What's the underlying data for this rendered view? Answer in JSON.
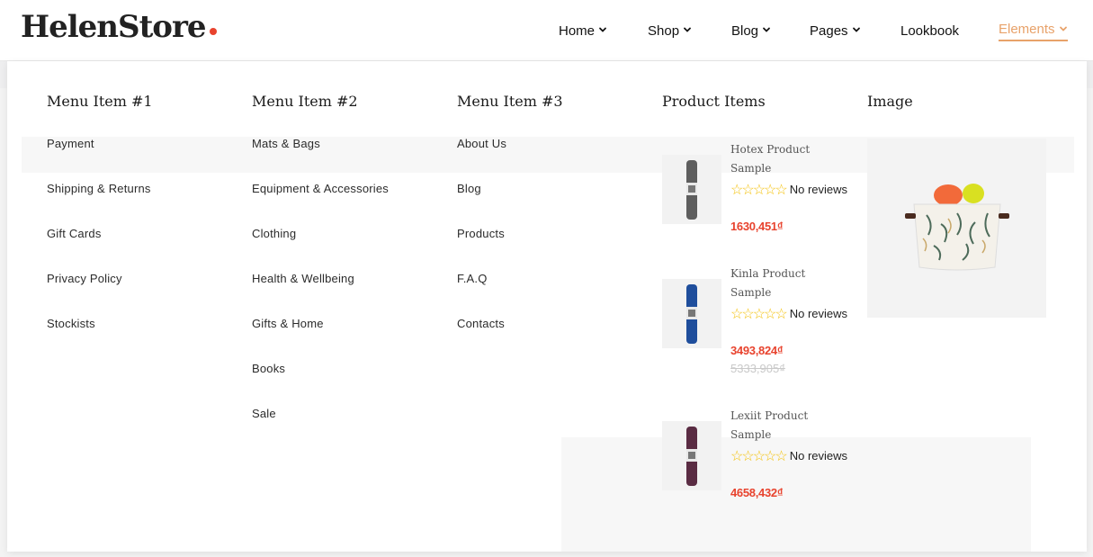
{
  "brand": {
    "name": "HelenStore",
    "dot_color": "#e8432e"
  },
  "nav": [
    {
      "label": "Home",
      "has_dropdown": true,
      "active": false
    },
    {
      "label": "Shop",
      "has_dropdown": true,
      "active": false
    },
    {
      "label": "Blog",
      "has_dropdown": true,
      "active": false
    },
    {
      "label": "Pages",
      "has_dropdown": true,
      "active": false
    },
    {
      "label": "Lookbook",
      "has_dropdown": false,
      "active": false
    },
    {
      "label": "Elements",
      "has_dropdown": true,
      "active": true
    }
  ],
  "colors": {
    "accent": "#e8a26a",
    "price": "#e8432e",
    "star": "#f4c20d"
  },
  "megamenu": {
    "col1": {
      "title": "Menu Item #1",
      "items": [
        "Payment",
        "Shipping & Returns",
        "Gift Cards",
        "Privacy Policy",
        "Stockists"
      ]
    },
    "col2": {
      "title": "Menu Item #2",
      "items": [
        "Mats & Bags",
        "Equipment & Accessories",
        "Clothing",
        "Health & Wellbeing",
        "Gifts & Home",
        "Books",
        "Sale"
      ]
    },
    "col3": {
      "title": "Menu Item #3",
      "items": [
        "About Us",
        "Blog",
        "Products",
        "F.A.Q",
        "Contacts"
      ]
    },
    "products": {
      "title": "Product Items",
      "items": [
        {
          "name": "Hotex Product Sample",
          "rating_text": "No reviews",
          "price": "1630,451₫",
          "old_price": "",
          "mat_color": "#5e5e5e"
        },
        {
          "name": "Kinla Product Sample",
          "rating_text": "No reviews",
          "price": "3493,824₫",
          "old_price": "5333,905₫",
          "mat_color": "#1f4e9c"
        },
        {
          "name": "Lexiit Product Sample",
          "rating_text": "No reviews",
          "price": "4658,432₫",
          "old_price": "",
          "mat_color": "#5a2c43"
        }
      ]
    },
    "image": {
      "title": "Image"
    }
  }
}
